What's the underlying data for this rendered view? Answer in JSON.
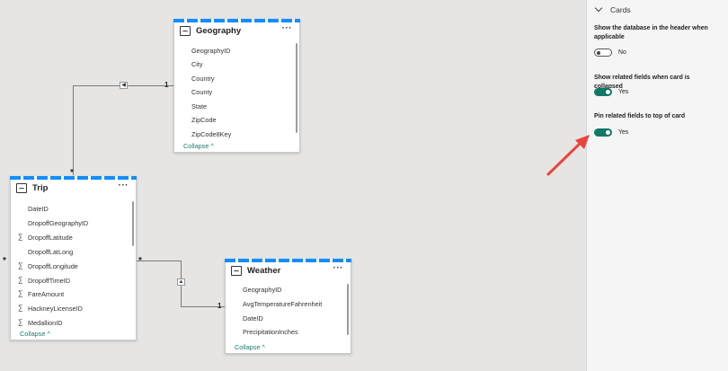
{
  "model_view": {
    "tables": {
      "geography": {
        "title": "Geography",
        "more_label": "···",
        "fields": [
          "GeographyID",
          "City",
          "Country",
          "County",
          "State",
          "ZipCode",
          "ZipCode8Key"
        ],
        "collapse_label": "Collapse ^"
      },
      "trip": {
        "title": "Trip",
        "more_label": "···",
        "fields": [
          {
            "name": "DateID",
            "sum": false
          },
          {
            "name": "DropoffGeographyID",
            "sum": false
          },
          {
            "name": "DropoffLatitude",
            "sum": true
          },
          {
            "name": "DropoffLatLong",
            "sum": false
          },
          {
            "name": "DropoffLongitude",
            "sum": true
          },
          {
            "name": "DropoffTimeID",
            "sum": true
          },
          {
            "name": "FareAmount",
            "sum": true
          },
          {
            "name": "HackneyLicenseID",
            "sum": true
          },
          {
            "name": "MedallionID",
            "sum": true
          }
        ],
        "collapse_label": "Collapse ^"
      },
      "weather": {
        "title": "Weather",
        "more_label": "···",
        "fields": [
          "GeographyID",
          "AvgTemperatureFahrenheit",
          "DateID",
          "PrecipitationInches"
        ],
        "collapse_label": "Collapse ^"
      }
    },
    "relationships": {
      "geo_trip": {
        "one_label": "1",
        "many_label": "*",
        "direction_glyph": "◀"
      },
      "weather_trip": {
        "one_label": "1",
        "many_label": "*",
        "direction_glyph": "▲",
        "trip_left_many": "*"
      }
    },
    "sum_glyph": "∑"
  },
  "properties_panel": {
    "section_title": "Cards",
    "settings": [
      {
        "label": "Show the database in the header when applicable",
        "state": "off",
        "state_text": "No"
      },
      {
        "label": "Show related fields when card is collapsed",
        "state": "on",
        "state_text": "Yes"
      },
      {
        "label": "Pin related fields to top of card",
        "state": "on",
        "state_text": "Yes"
      }
    ]
  },
  "colors": {
    "accent_stripe": "#118dff",
    "toggle_on": "#117865",
    "arrow": "#e8453c",
    "canvas": "#e6e5e4"
  }
}
